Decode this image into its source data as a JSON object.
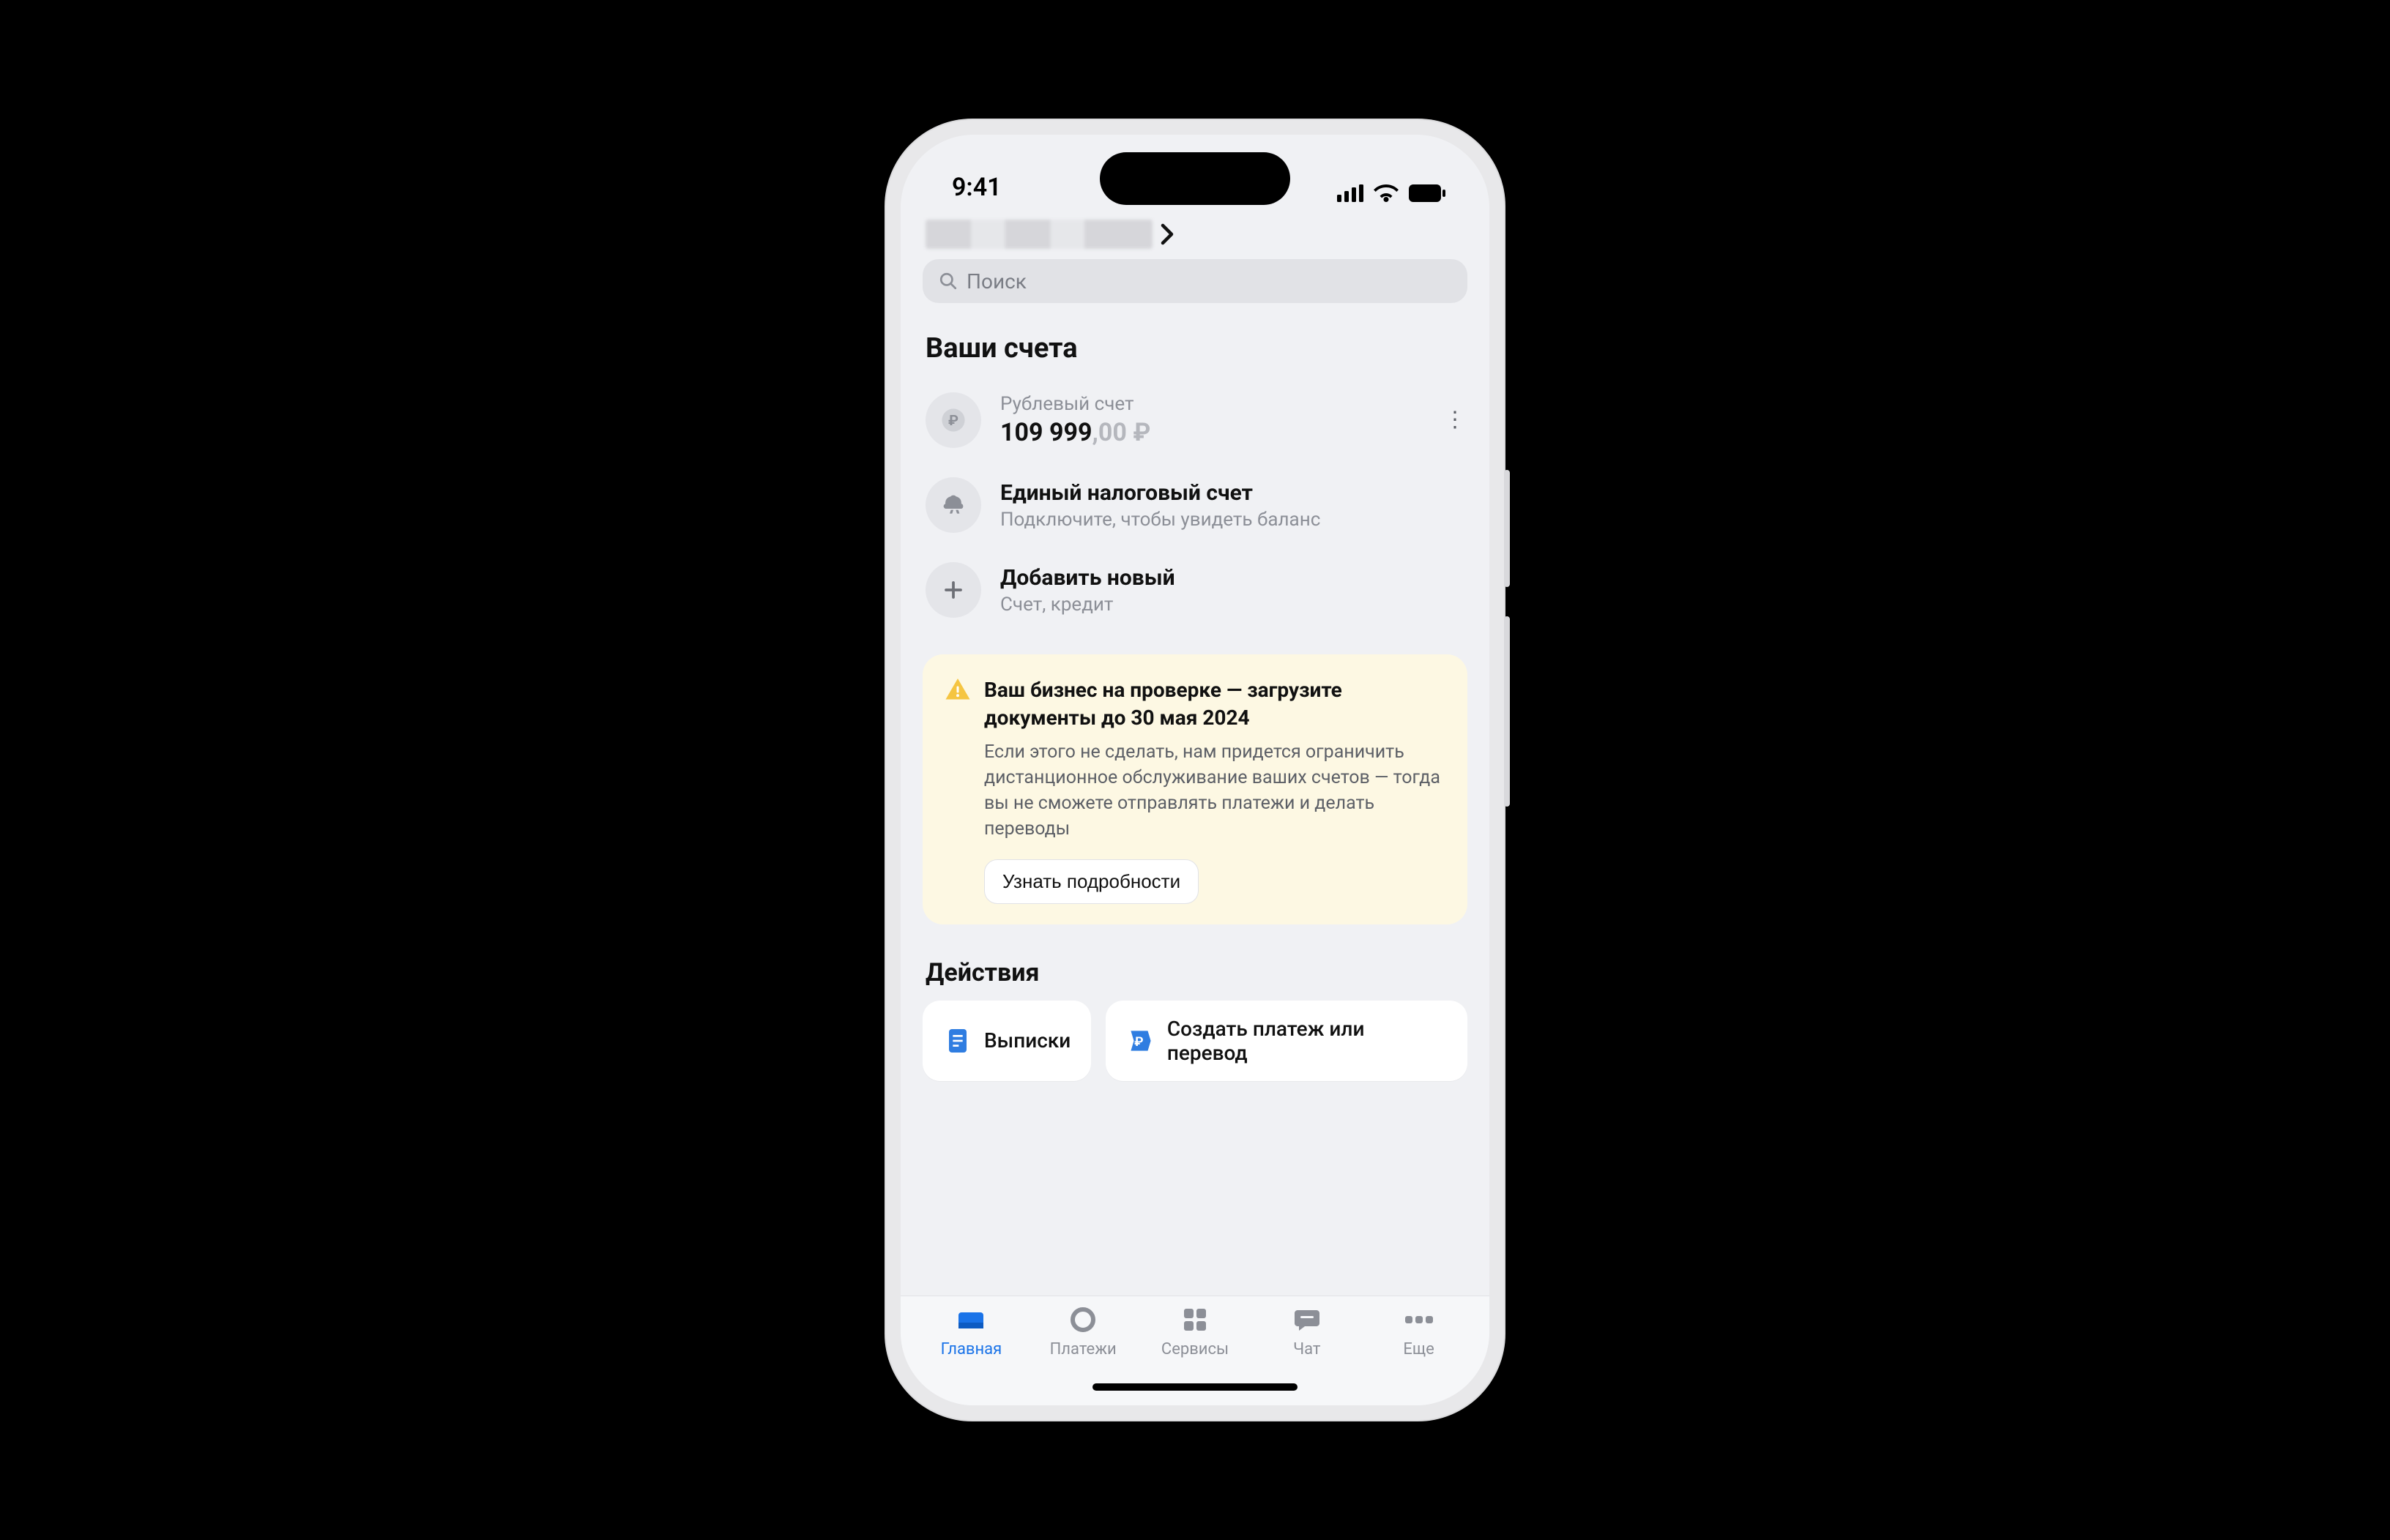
{
  "status": {
    "time": "9:41"
  },
  "search": {
    "placeholder": "Поиск"
  },
  "accounts": {
    "title": "Ваши счета",
    "ruble": {
      "label": "Рублевый счет",
      "balance_main": "109 999",
      "balance_dec": ",00 ₽"
    },
    "tax": {
      "title": "Единый налоговый счет",
      "sub": "Подключите, чтобы увидеть баланс"
    },
    "add": {
      "title": "Добавить новый",
      "sub": "Счет, кредит"
    }
  },
  "alert": {
    "title": "Ваш бизнес на проверке — загрузите документы до 30 мая 2024",
    "text": "Если этого не сделать, нам придется ограничить дистанционное обслуживание ваших счетов — тогда вы не сможете отправлять платежи и делать переводы",
    "button": "Узнать подробности"
  },
  "actions": {
    "title": "Действия",
    "statements": "Выписки",
    "create_payment": "Создать платеж или перевод"
  },
  "tabs": {
    "home": "Главная",
    "payments": "Платежи",
    "services": "Сервисы",
    "chat": "Чат",
    "more": "Еще"
  }
}
